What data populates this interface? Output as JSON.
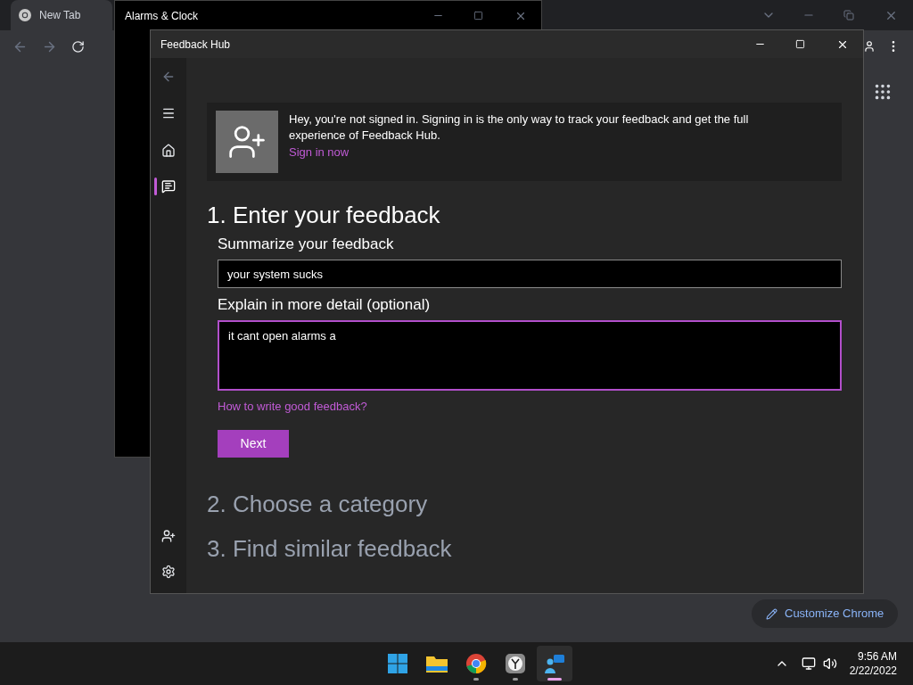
{
  "browser": {
    "tab_title": "New Tab",
    "customize_button": "Customize Chrome"
  },
  "background_window": {
    "title": "Alarms & Clock"
  },
  "window": {
    "title": "Feedback Hub"
  },
  "nav": [
    {
      "kind": "home",
      "selected": false
    },
    {
      "kind": "feedback",
      "selected": true
    }
  ],
  "nav_bottom": [
    {
      "kind": "account",
      "selected": false
    },
    {
      "kind": "settings",
      "selected": false
    }
  ],
  "signin_banner": {
    "message": "Hey, you're not signed in. Signing in is the only way to track your feedback and get the full experience of Feedback Hub.",
    "link": "Sign in now"
  },
  "steps": [
    {
      "title": "1. Enter your feedback",
      "active": true
    },
    {
      "title": "2. Choose a category",
      "active": false
    },
    {
      "title": "3. Find similar feedback",
      "active": false
    }
  ],
  "form": {
    "summary_label": "Summarize your feedback",
    "summary_value": "your system sucks",
    "detail_label": "Explain in more detail (optional)",
    "detail_value": "it cant open alarms a",
    "detail_focused": true,
    "help_link": "How to write good feedback?",
    "next_button": "Next"
  },
  "taskbar": {
    "apps": [
      {
        "kind": "start",
        "running": false,
        "selected": false
      },
      {
        "kind": "folder",
        "running": false,
        "selected": false
      },
      {
        "kind": "chrome",
        "running": true,
        "selected": false
      },
      {
        "kind": "clock",
        "running": true,
        "selected": false
      },
      {
        "kind": "feedback",
        "running": true,
        "selected": true
      }
    ],
    "time": "9:56 AM",
    "date": "2/22/2022"
  }
}
